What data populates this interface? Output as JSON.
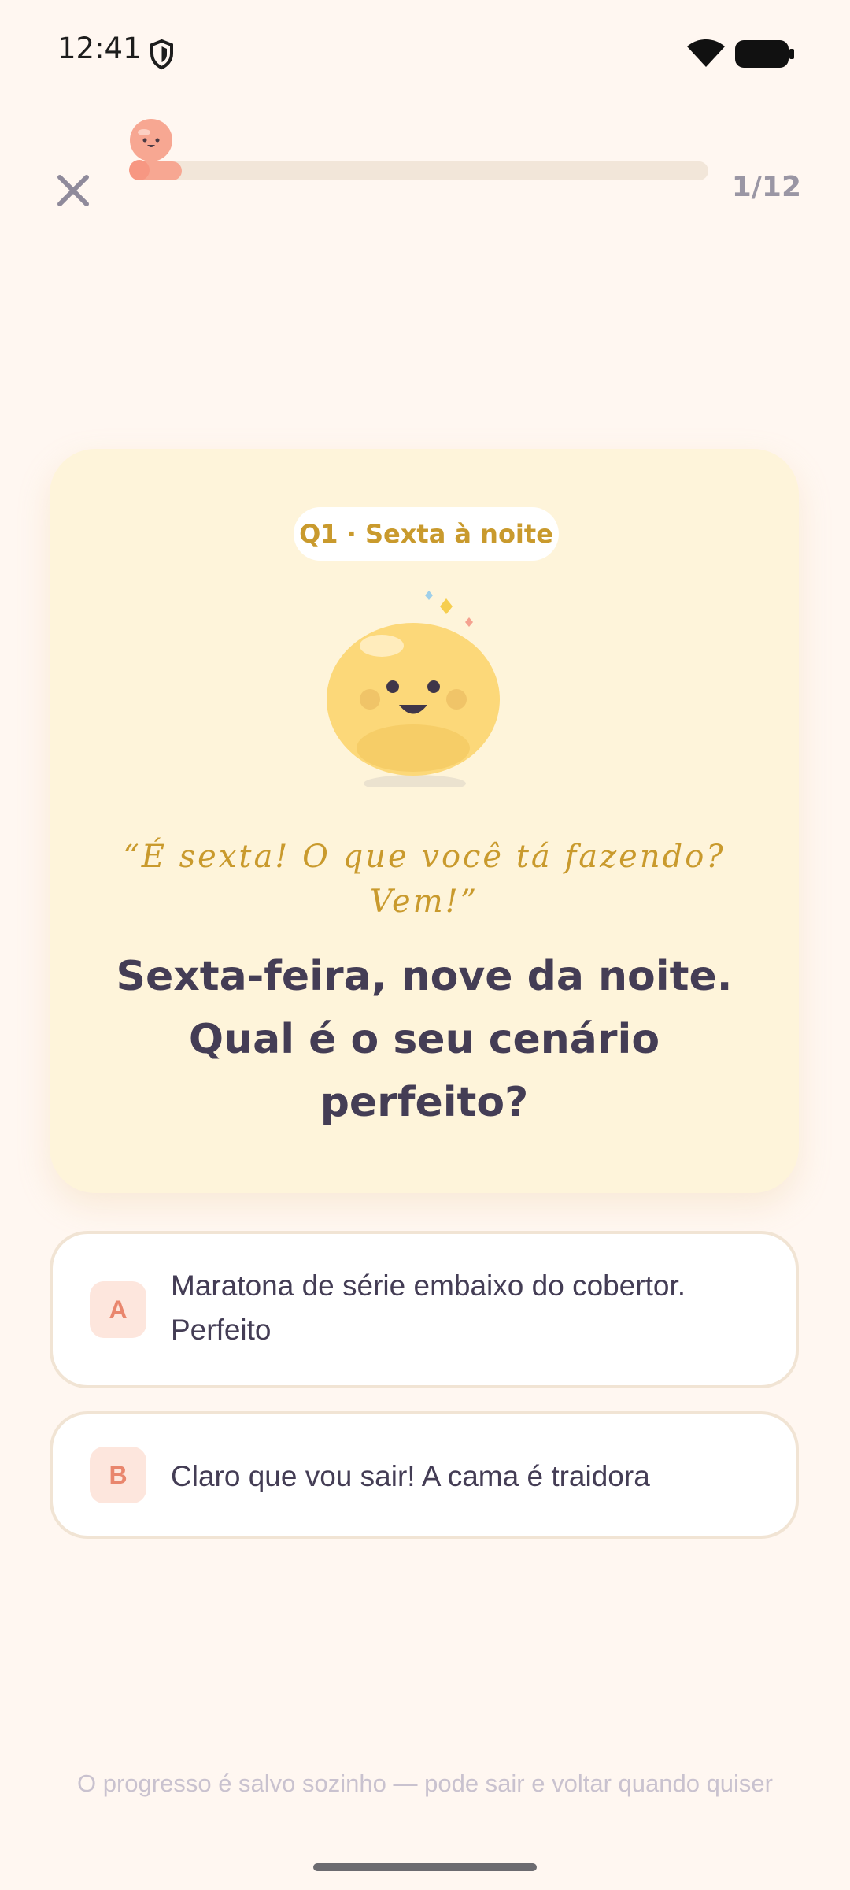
{
  "status_bar": {
    "time": "12:41"
  },
  "quiz": {
    "progress": {
      "current": 1,
      "total": 12,
      "label": "1/12",
      "fraction": 0.0833
    }
  },
  "question_card": {
    "category": "Q1 · Sexta à noite",
    "mascot_quote_line1": "“É sexta! O que você tá fazendo?",
    "mascot_quote_line2": "Vem!”",
    "question_line1": "Sexta-feira, nove da noite.",
    "question_line2": "Qual é o seu cenário",
    "question_line3": "perfeito?"
  },
  "answers": [
    {
      "letter": "A",
      "text_line1": "Maratona de série embaixo do cobertor.",
      "text_line2": "Perfeito"
    },
    {
      "letter": "B",
      "text_line1": "Claro que vou sair! A cama é traidora"
    }
  ],
  "footer": {
    "note": "O progresso é salvo sozinho — pode sair e voltar quando quiser"
  },
  "colors": {
    "background": "#fff7f1",
    "card": "#fef4da",
    "accent_gold": "#c99a2d",
    "accent_coral": "#f7a792",
    "text_dark": "#443d55",
    "muted": "#9a96a4"
  },
  "icons": {
    "status_left": "shield-icon",
    "status_right": [
      "wifi-icon",
      "battery-icon"
    ],
    "close": "close-icon",
    "progress_marker": "mascot-progress-marker",
    "card_illustration": "smiling-blob-mascot"
  }
}
